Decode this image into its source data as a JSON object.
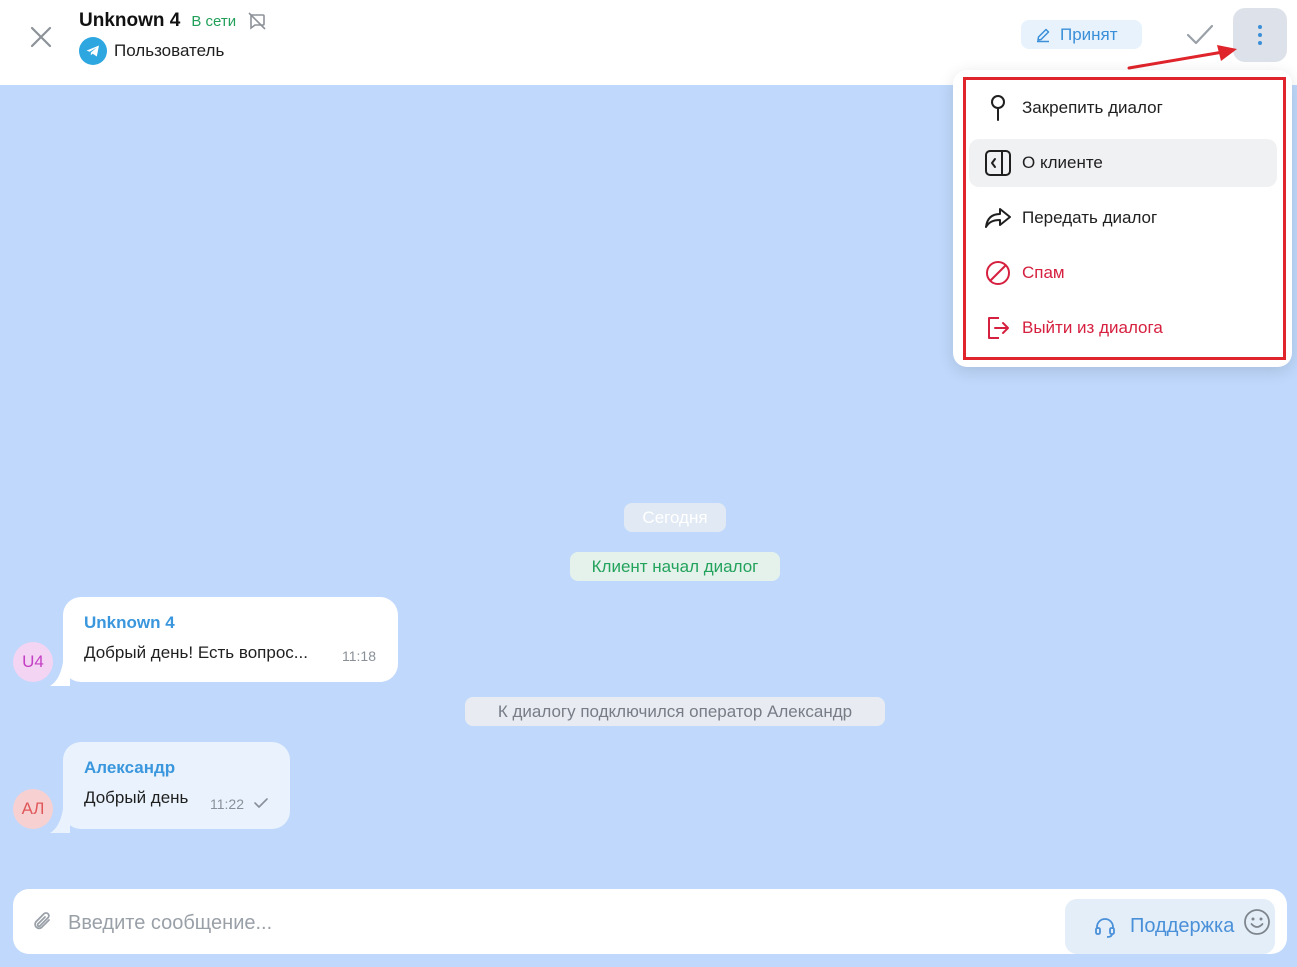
{
  "header": {
    "title": "Unknown 4",
    "status": "В сети",
    "channel_label": "Пользователь",
    "accepted_label": "Принят"
  },
  "chat": {
    "date_separator": "Сегодня",
    "client_started": "Клиент начал диалог",
    "operator_joined": "К диалогу подключился оператор Александр",
    "messages": [
      {
        "avatar": "U4",
        "author": "Unknown 4",
        "text": "Добрый день! Есть вопрос...",
        "time": "11:18"
      },
      {
        "avatar": "АЛ",
        "author": "Александр",
        "text": "Добрый день",
        "time": "11:22"
      }
    ]
  },
  "input": {
    "placeholder": "Введите сообщение...",
    "support_label": "Поддержка"
  },
  "menu": {
    "items": [
      {
        "label": "Закрепить диалог",
        "icon": "pin-icon"
      },
      {
        "label": "О клиенте",
        "icon": "client-panel-icon"
      },
      {
        "label": "Передать диалог",
        "icon": "forward-icon"
      },
      {
        "label": "Спам",
        "icon": "spam-icon"
      },
      {
        "label": "Выйти из диалога",
        "icon": "logout-icon"
      }
    ]
  },
  "colors": {
    "chat_bg": "#bfd8fb",
    "accent": "#3a97dd",
    "online": "#22a05a",
    "danger": "#d6203f",
    "highlight": "#e0242b"
  }
}
